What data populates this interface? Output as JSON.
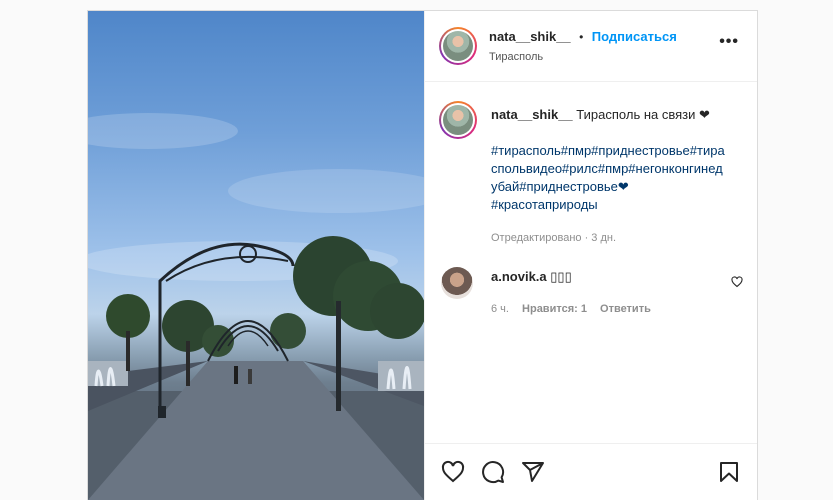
{
  "post": {
    "username": "nata__shik__",
    "separator": "•",
    "follow_label": "Подписаться",
    "location": "Тирасполь",
    "more_label": "•••"
  },
  "caption": {
    "username": "nata__shik__",
    "text": "Тирасполь на связи ❤",
    "hashtags": "#тирасполь#пмр#приднестровье#тирасопольвидео#рилс#пмр#негонконгинедубай#приднестровье❤ #красотаприроды",
    "hashtag_lines": [
      "#тирасполь#пмр#приднестровье#тира",
      "спольвидео#рилс#пмр#негонконгинед",
      "убай#приднестровье❤",
      "#красотаприроды"
    ],
    "edited": "Отредактировано · 3 дн."
  },
  "comment": {
    "username": "a.novik.a",
    "text": "▯▯▯",
    "time": "6 ч.",
    "likes": "Нравится: 1",
    "reply": "Ответить"
  },
  "icons": [
    "more-icon",
    "heart-icon",
    "comment-icon",
    "share-icon",
    "bookmark-icon",
    "like-comment-icon"
  ],
  "colors": {
    "link": "#0095f6",
    "hashtag": "#00376b",
    "meta": "#8e8e8e"
  }
}
